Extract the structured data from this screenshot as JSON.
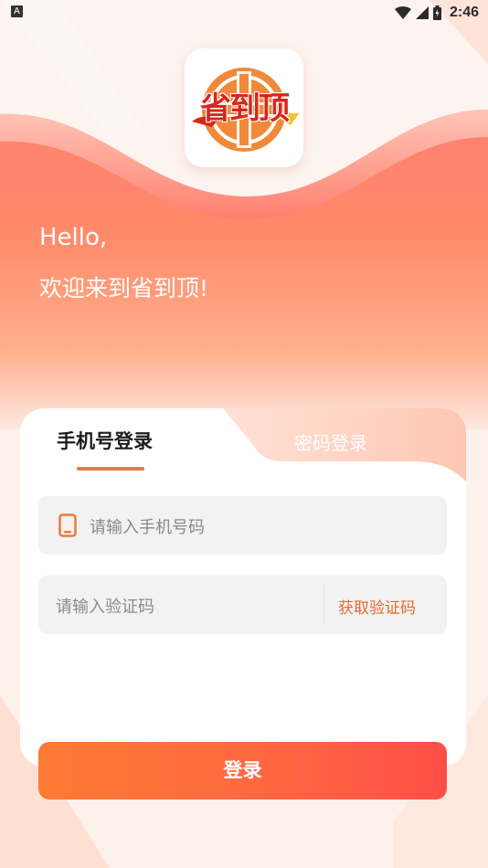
{
  "status_bar": {
    "notification_letter": "A",
    "time": "2:46"
  },
  "logo": {
    "text": "省到顶"
  },
  "greeting": {
    "line1": "Hello,",
    "line2": "欢迎来到省到顶!"
  },
  "tabs": [
    {
      "label": "手机号登录",
      "active": true
    },
    {
      "label": "密码登录",
      "active": false
    }
  ],
  "phone_field": {
    "placeholder": "请输入手机号码",
    "icon": "phone-icon"
  },
  "code_field": {
    "placeholder": "请输入验证码",
    "get_code_label": "获取验证码"
  },
  "login_button": {
    "label": "登录"
  },
  "colors": {
    "accent": "#f07a35",
    "button_start": "#ff7a33",
    "button_end": "#ff4f48",
    "header_gradient_top": "#ff7366",
    "header_gradient_bottom": "#ffa27a"
  }
}
